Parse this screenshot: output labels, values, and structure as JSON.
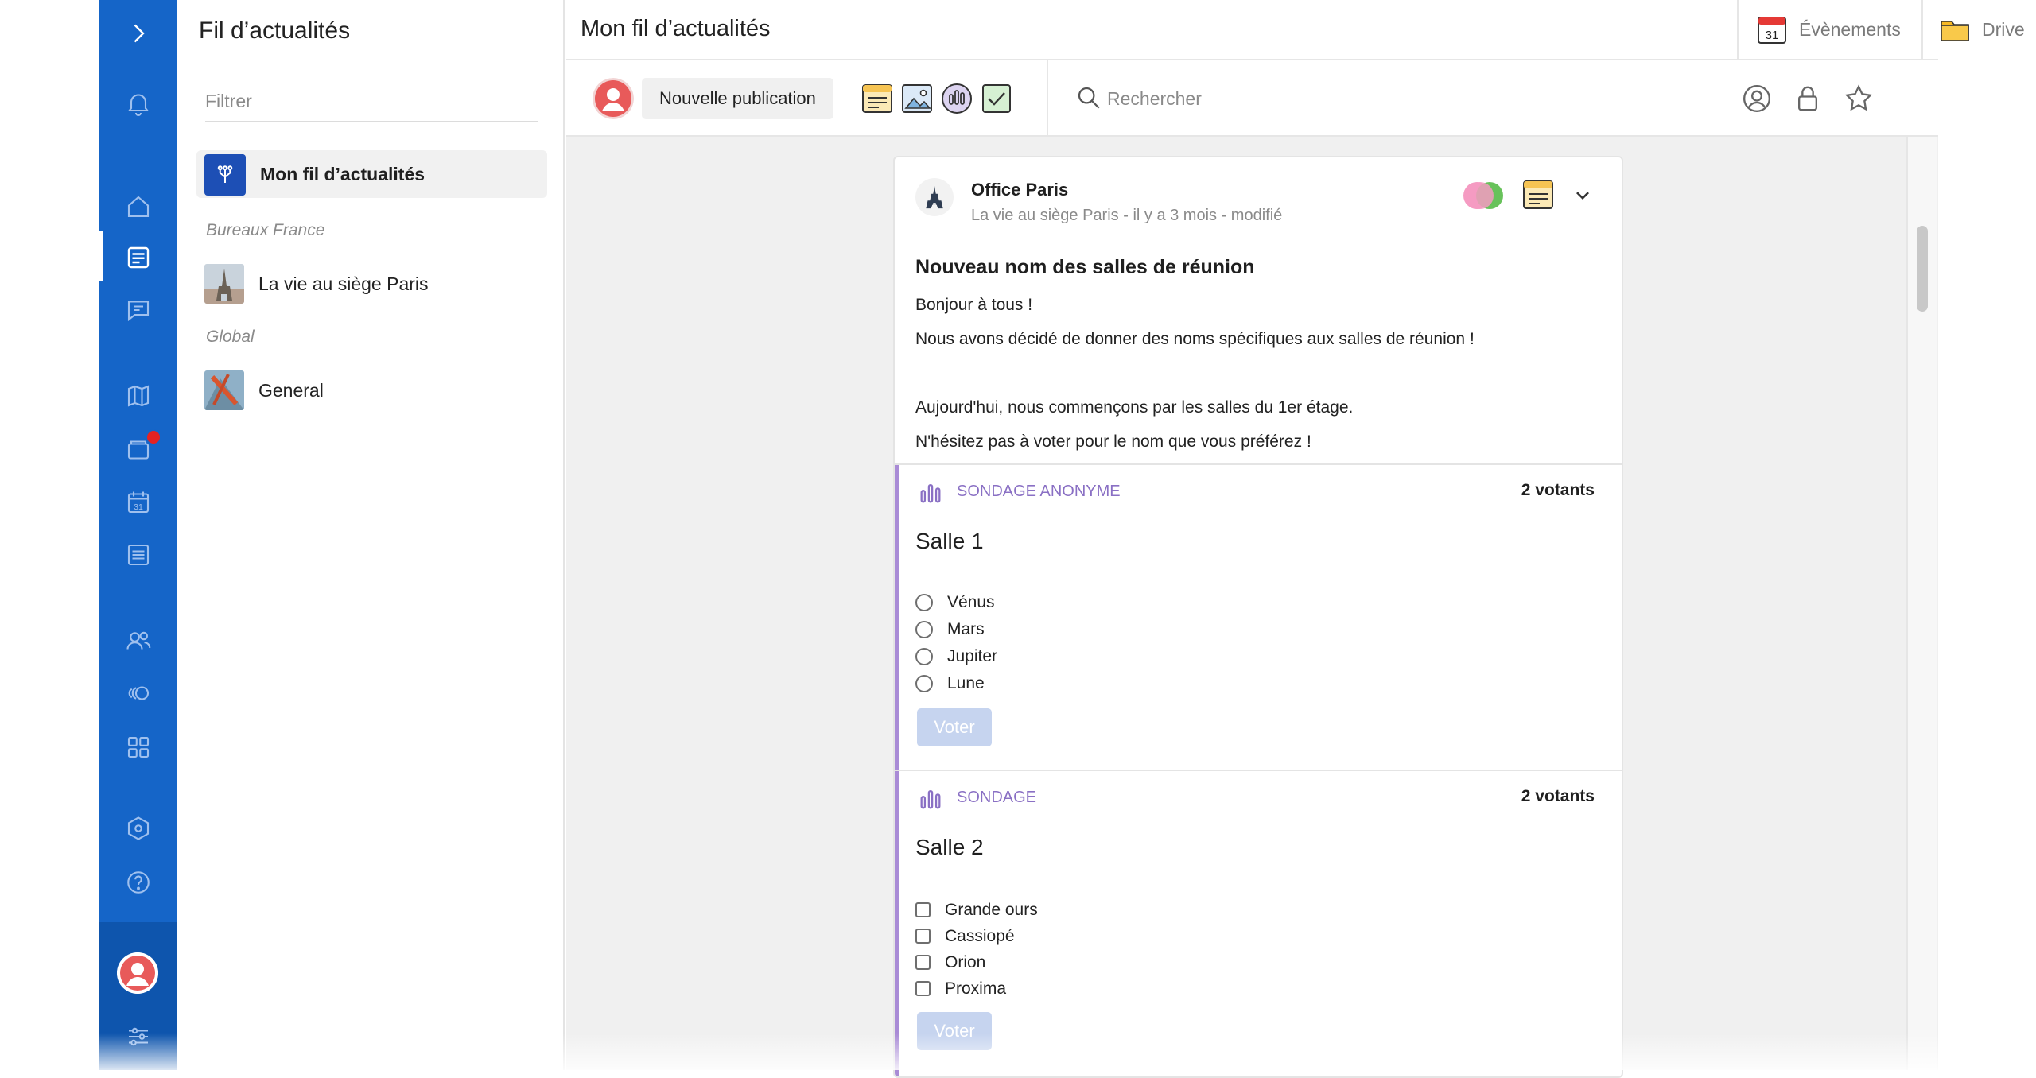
{
  "left_panel": {
    "title": "Fil d’actualités",
    "filter_placeholder": "Filtrer",
    "feed_item_label": "Mon fil d’actualités",
    "sections": [
      {
        "name": "Bureaux France",
        "groups": [
          {
            "label": "La vie au siège Paris"
          }
        ]
      },
      {
        "name": "Global",
        "groups": [
          {
            "label": "General"
          }
        ]
      }
    ]
  },
  "header": {
    "title": "Mon fil d’actualités",
    "events_label": "Évènements",
    "drive_label": "Drive",
    "calendar_day": "31"
  },
  "toolbar": {
    "new_post_label": "Nouvelle publication",
    "search_placeholder": "Rechercher"
  },
  "post": {
    "author": "Office Paris",
    "meta": "La vie au siège Paris - il y a 3 mois  - modifié",
    "title": "Nouveau nom des salles de réunion",
    "body": [
      "Bonjour à tous !",
      "Nous avons décidé de donner des noms spécifiques aux salles de réunion !",
      "",
      "Aujourd'hui, nous commençons par les salles du 1er étage.",
      "N'hésitez pas à voter pour le nom que vous préférez !"
    ],
    "polls": [
      {
        "type": "SONDAGE ANONYME",
        "votes": "2 votants",
        "question": "Salle 1",
        "options": [
          "Vénus",
          "Mars",
          "Jupiter",
          "Lune"
        ],
        "vote_label": "Voter"
      },
      {
        "type": "SONDAGE",
        "votes": "2 votants",
        "question": "Salle 2",
        "options": [
          "Grande ours",
          "Cassiopé",
          "Orion",
          "Proxima"
        ],
        "vote_label": "Voter"
      }
    ]
  },
  "colors": {
    "rail_blue": "#1565c8",
    "accent_purple": "#8a70c4",
    "notification_red": "#e52222",
    "vote_button_disabled": "#c6d4ef"
  }
}
